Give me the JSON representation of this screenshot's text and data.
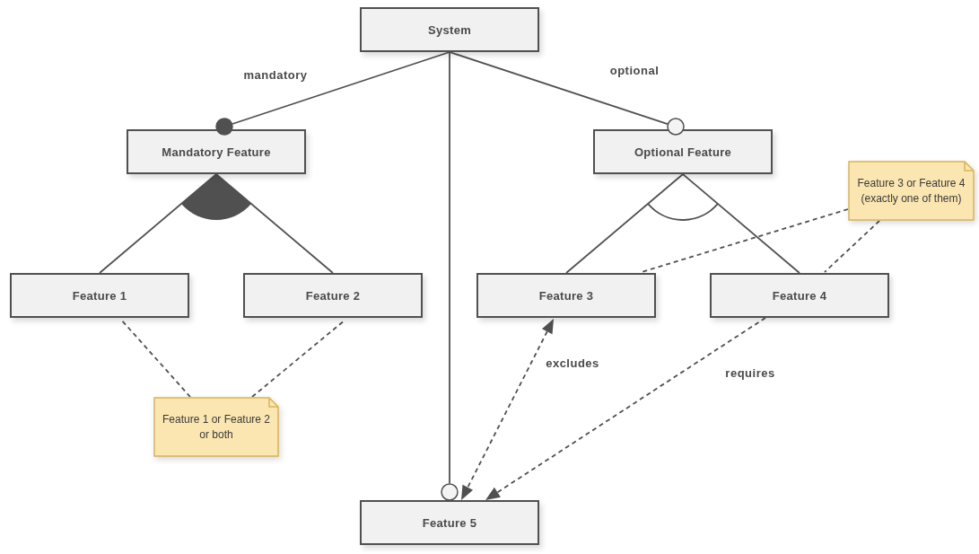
{
  "root": {
    "label": "System",
    "children": [
      {
        "label": "Mandatory Feature",
        "relation": {
          "kind": "mandatory",
          "label": "mandatory"
        },
        "group": {
          "kind": "or"
        },
        "children": [
          {
            "label": "Feature 1"
          },
          {
            "label": "Feature 2"
          }
        ]
      },
      {
        "label": "Optional Feature",
        "relation": {
          "kind": "optional",
          "label": "optional"
        },
        "group": {
          "kind": "alternative"
        },
        "children": [
          {
            "label": "Feature 3"
          },
          {
            "label": "Feature 4"
          }
        ]
      },
      {
        "label": "Feature 5",
        "relation": {
          "kind": "optional"
        }
      }
    ]
  },
  "notes": [
    {
      "text": "Feature 1 or Feature 2 or both"
    },
    {
      "text": "Feature 3 or Feature 4 (exactly one of them)"
    }
  ],
  "constraints": [
    {
      "kind": "excludes",
      "label": "excludes"
    },
    {
      "kind": "requires",
      "label": "requires"
    }
  ]
}
